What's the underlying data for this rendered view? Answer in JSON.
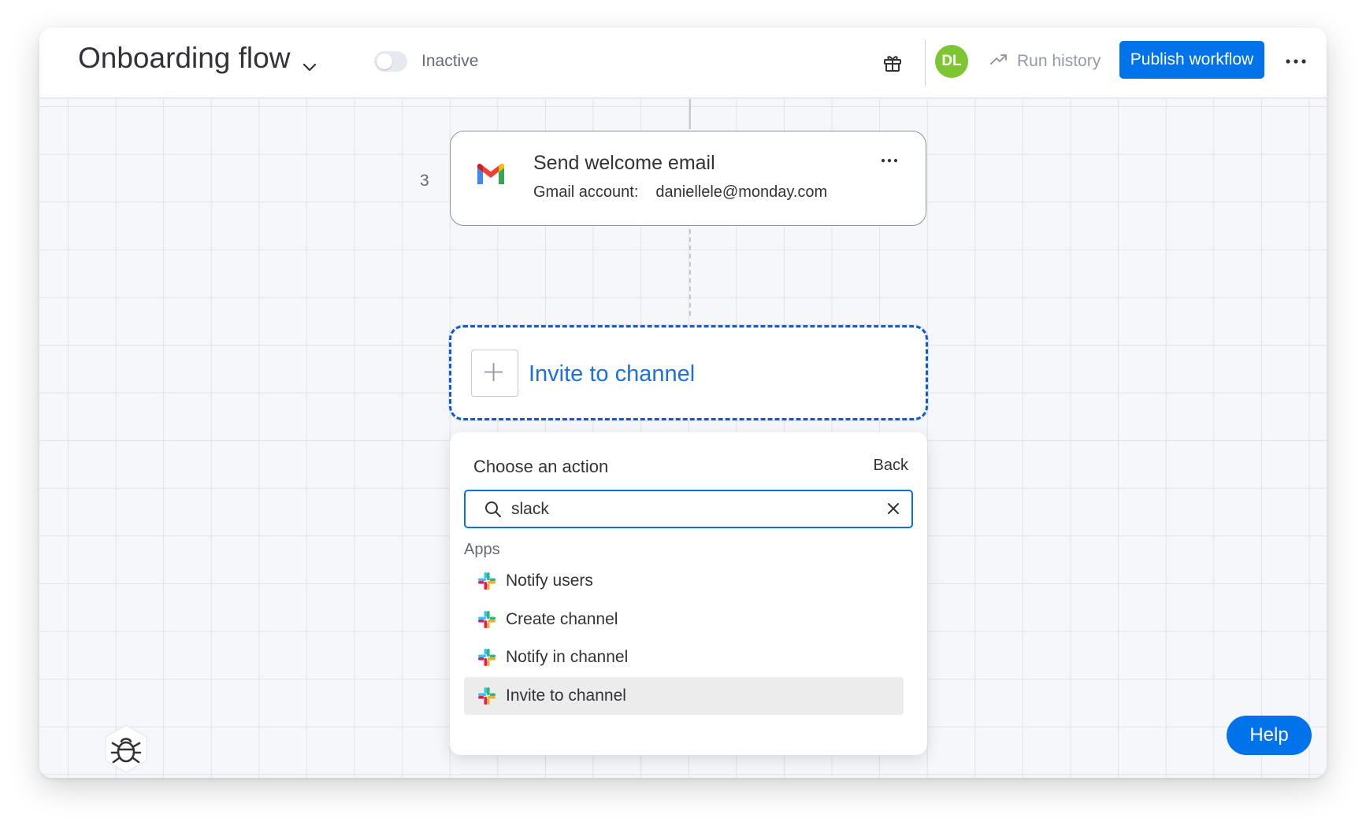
{
  "header": {
    "title": "Onboarding flow",
    "status_label": "Inactive",
    "avatar_initials": "DL",
    "run_history_label": "Run history",
    "publish_label": "Publish workflow"
  },
  "step": {
    "number": "3",
    "title": "Send welcome email",
    "account_label": "Gmail account:",
    "account_value": "daniellele@monday.com"
  },
  "placeholder": {
    "title": "Invite to channel"
  },
  "action_picker": {
    "title": "Choose an action",
    "back_label": "Back",
    "search_value": "slack",
    "section_label": "Apps",
    "items": [
      {
        "label": "Notify users"
      },
      {
        "label": "Create channel"
      },
      {
        "label": "Notify in channel"
      },
      {
        "label": "Invite to channel"
      }
    ]
  },
  "help_label": "Help",
  "colors": {
    "accent": "#0073ea",
    "avatar": "#7ec534",
    "placeholder_border": "#0f5ad6",
    "selected_row": "#ececec"
  },
  "icons": [
    "chevron-down-icon",
    "gift-icon",
    "trend-icon",
    "more-icon",
    "gmail-icon",
    "plus-icon",
    "search-icon",
    "close-icon",
    "slack-icon",
    "bug-icon"
  ]
}
